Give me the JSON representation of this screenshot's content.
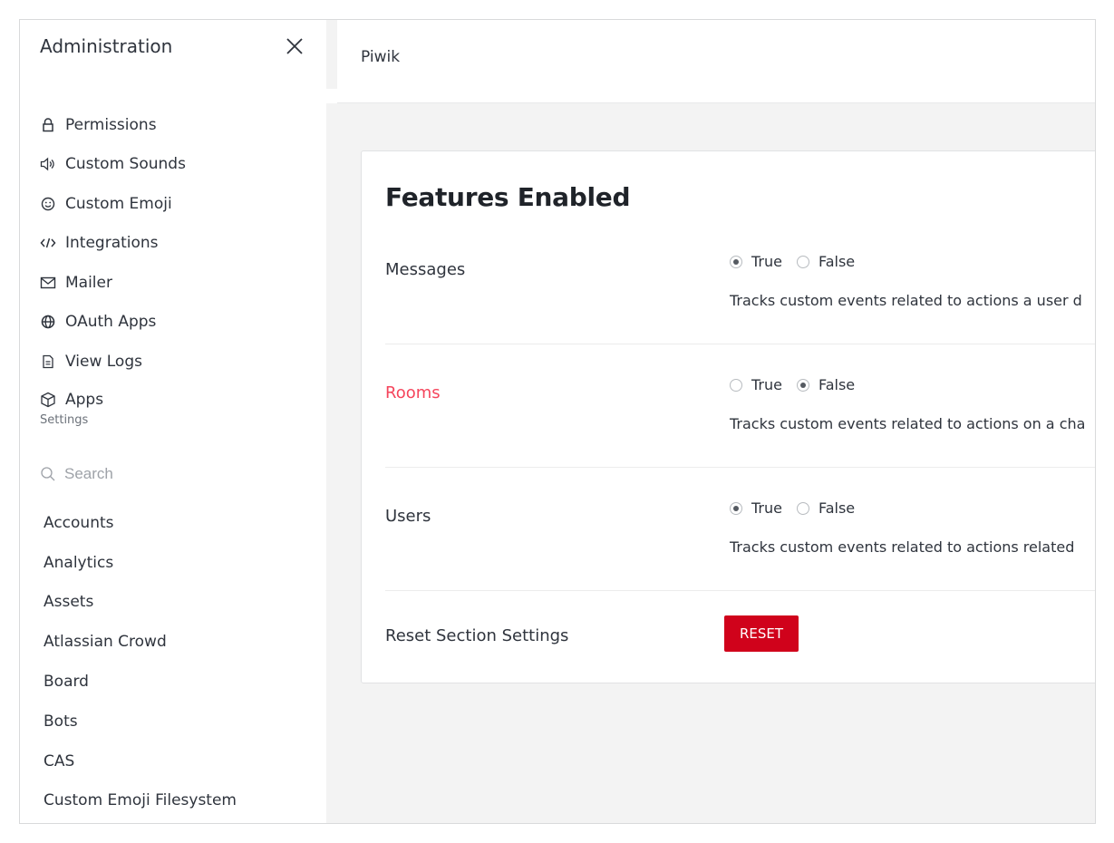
{
  "sidebar": {
    "title": "Administration",
    "items": [
      {
        "label": "Permissions",
        "icon": "lock-icon"
      },
      {
        "label": "Custom Sounds",
        "icon": "volume-icon"
      },
      {
        "label": "Custom Emoji",
        "icon": "emoji-icon"
      },
      {
        "label": "Integrations",
        "icon": "code-icon"
      },
      {
        "label": "Mailer",
        "icon": "mail-icon"
      },
      {
        "label": "OAuth Apps",
        "icon": "globe-icon"
      },
      {
        "label": "View Logs",
        "icon": "file-icon"
      },
      {
        "label": "Apps",
        "icon": "cube-icon"
      }
    ],
    "settings_label": "Settings",
    "search": {
      "placeholder": "Search",
      "value": ""
    },
    "groups": [
      "Accounts",
      "Analytics",
      "Assets",
      "Atlassian Crowd",
      "Board",
      "Bots",
      "CAS",
      "Custom Emoji Filesystem"
    ]
  },
  "header": {
    "title": "Piwik"
  },
  "section": {
    "title": "Features Enabled",
    "settings": [
      {
        "label": "Messages",
        "true_label": "True",
        "false_label": "False",
        "selected": "True",
        "changed": false,
        "description": "Tracks custom events related to actions a user d"
      },
      {
        "label": "Rooms",
        "true_label": "True",
        "false_label": "False",
        "selected": "False",
        "changed": true,
        "description": "Tracks custom events related to actions on a cha"
      },
      {
        "label": "Users",
        "true_label": "True",
        "false_label": "False",
        "selected": "True",
        "changed": false,
        "description": "Tracks custom events related to actions related"
      }
    ],
    "reset_label": "Reset Section Settings",
    "reset_button": "RESET"
  },
  "colors": {
    "accent_red": "#d0021b",
    "changed_label": "#f5455c"
  }
}
